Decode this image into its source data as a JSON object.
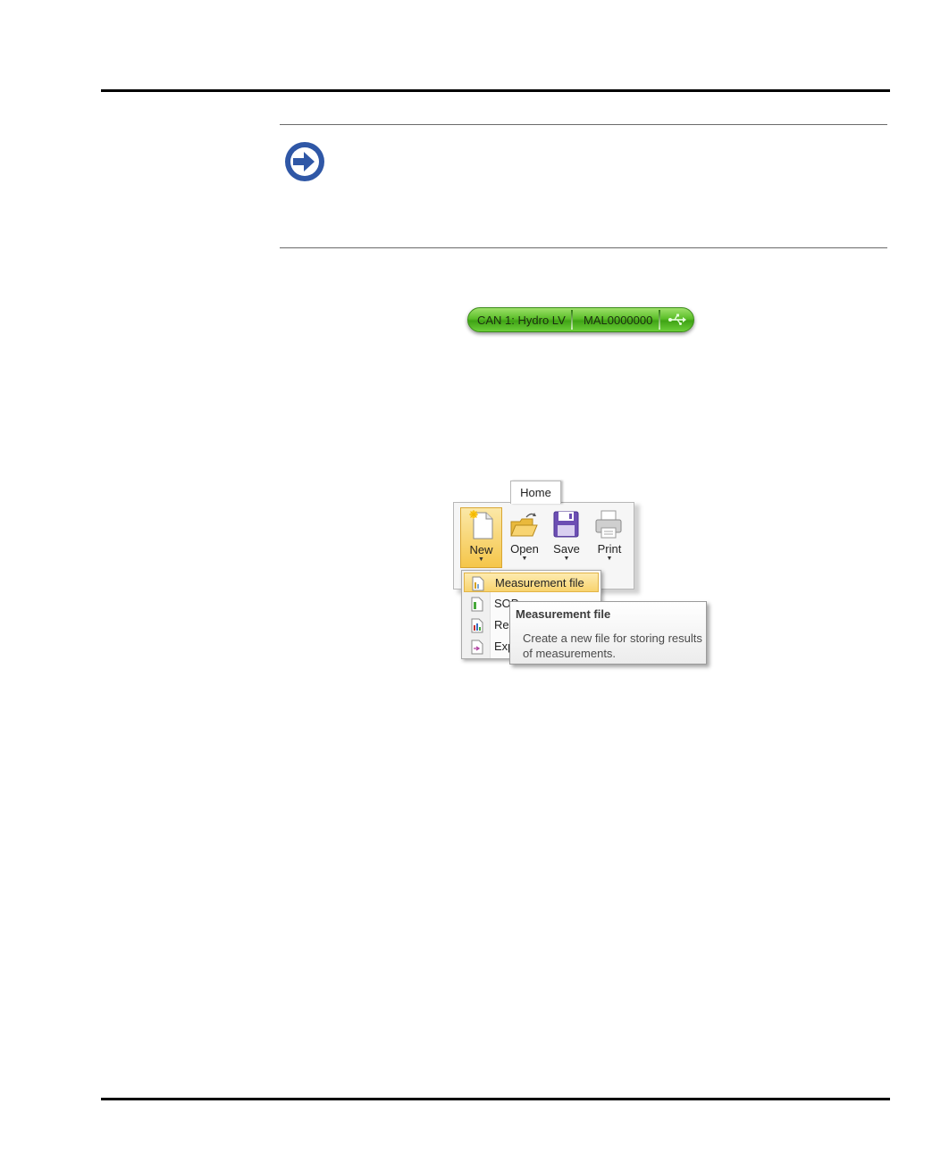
{
  "note": {
    "icon": "arrow-right-circle-icon"
  },
  "status_bar": {
    "interface_label": "CAN 1: Hydro LV",
    "device_label": "MAL0000000",
    "connection_icon": "usb-icon",
    "color": "#5cbf2a"
  },
  "ribbon": {
    "tab": "Home",
    "buttons": [
      {
        "label": "New",
        "icon": "new-document-icon"
      },
      {
        "label": "Open",
        "icon": "open-folder-icon"
      },
      {
        "label": "Save",
        "icon": "floppy-disk-icon"
      },
      {
        "label": "Print",
        "icon": "printer-icon"
      }
    ],
    "dropdown_items": [
      {
        "label": "Measurement file",
        "highlighted": true
      },
      {
        "label": "SOP"
      },
      {
        "label": "Rep"
      },
      {
        "label": "Exp"
      }
    ]
  },
  "tooltip": {
    "title": "Measurement file",
    "description": "Create a new file for storing results of measurements."
  },
  "colors": {
    "highlight": "#f8d36e",
    "note_icon": "#2f57a6"
  }
}
